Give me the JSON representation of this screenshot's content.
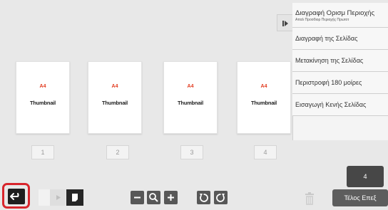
{
  "thumbnails": [
    {
      "size": "A4",
      "name": "Thumbnail",
      "page": "1"
    },
    {
      "size": "A4",
      "name": "Thumbnail",
      "page": "2"
    },
    {
      "size": "A4",
      "name": "Thumbnail",
      "page": "3"
    },
    {
      "size": "A4",
      "name": "Thumbnail",
      "page": "4"
    }
  ],
  "menu": {
    "delete_area_main": "Διαγραφή Ορισμ Περιοχής",
    "delete_area_sub": "Απαλ Προσδιορ Περιοχής Πρωτοτ",
    "items": [
      "Διαγραφή της Σελίδας",
      "Μετακίνηση της Σελίδας",
      "Περιστροφή 180 μοίρες",
      "Εισαγωγή Κενής Σελίδας"
    ]
  },
  "page_count": "4",
  "done_label": "Τέλος Επεξ",
  "icons": {
    "back": "undo-arrow-icon",
    "zoom_out": "minus-icon",
    "zoom": "magnifier-icon",
    "zoom_in": "plus-icon",
    "rotate_left": "rotate-left-icon",
    "rotate_right": "rotate-right-icon",
    "trash": "trash-icon",
    "menu_toggle": "collapse-menu-icon"
  },
  "colors": {
    "highlight": "#d8252c",
    "size_label": "#e23a1e"
  }
}
